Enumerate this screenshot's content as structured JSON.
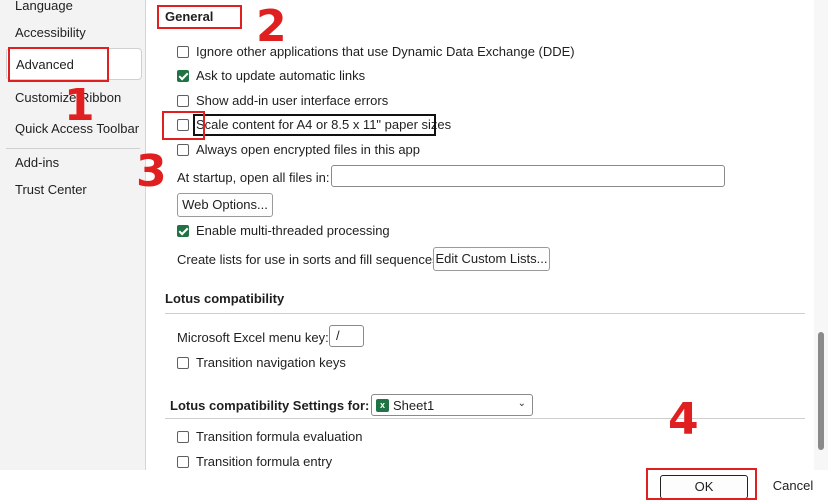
{
  "sidebar": {
    "items": [
      {
        "label": "Language"
      },
      {
        "label": "Accessibility"
      },
      {
        "label": "Advanced"
      },
      {
        "label": "Customize Ribbon"
      },
      {
        "label": "Quick Access Toolbar"
      },
      {
        "label": "Add-ins"
      },
      {
        "label": "Trust Center"
      }
    ],
    "selected": "Advanced"
  },
  "general": {
    "heading": "General",
    "options": [
      {
        "label": "Ignore other applications that use Dynamic Data Exchange (DDE)",
        "checked": false
      },
      {
        "label": "Ask to update automatic links",
        "checked": true
      },
      {
        "label": "Show add-in user interface errors",
        "checked": false
      },
      {
        "label": "Scale content for A4 or 8.5 x 11\" paper sizes",
        "checked": false
      },
      {
        "label": "Always open encrypted files in this app",
        "checked": false
      }
    ],
    "startup_label": "At startup, open all files in:",
    "startup_value": "",
    "web_options_button": "Web Options...",
    "multithread_label": "Enable multi-threaded processing",
    "multithread_checked": true,
    "custom_lists_label": "Create lists for use in sorts and fill sequences:",
    "custom_lists_button": "Edit Custom Lists..."
  },
  "lotus": {
    "heading": "Lotus compatibility",
    "menu_key_label": "Microsoft Excel menu key:",
    "menu_key_value": "/",
    "nav_keys_label": "Transition navigation keys",
    "nav_keys_checked": false
  },
  "lotus_settings": {
    "heading": "Lotus compatibility Settings for:",
    "sheet_value": "Sheet1",
    "formula_eval_label": "Transition formula evaluation",
    "formula_entry_label": "Transition formula entry"
  },
  "footer": {
    "ok_label": "OK",
    "cancel_label": "Cancel"
  },
  "annotations": {
    "n1": "1",
    "n2": "2",
    "n3": "3",
    "n4": "4",
    "color": "#e02020"
  },
  "colors": {
    "accent_green": "#217346"
  }
}
